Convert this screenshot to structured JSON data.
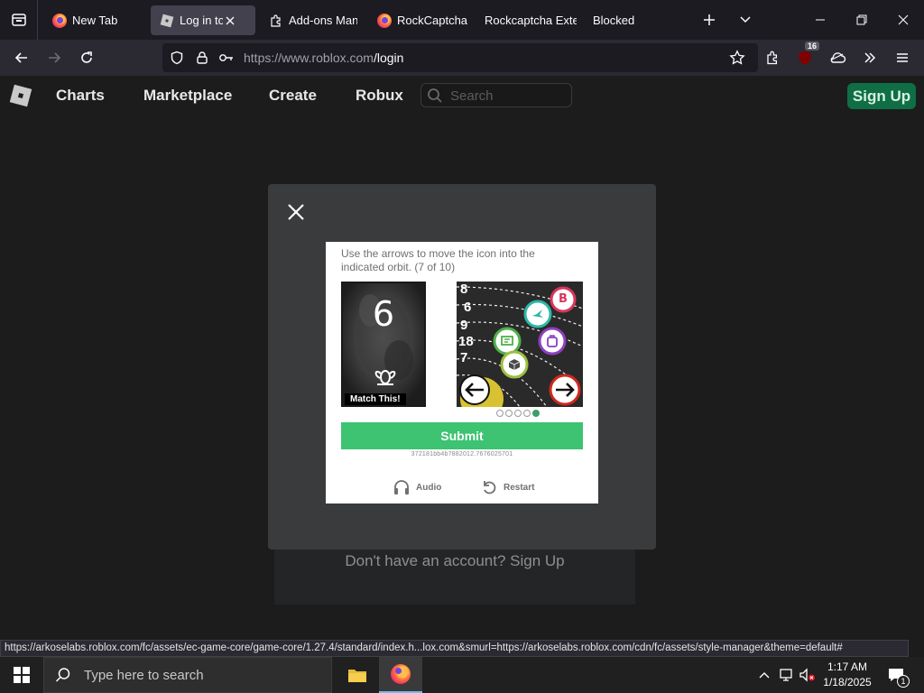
{
  "browser": {
    "tabs": [
      {
        "title": "New Tab",
        "icon": "firefox-icon",
        "active": false
      },
      {
        "title": "Log in to Ro",
        "icon": "roblox-favicon",
        "active": true
      },
      {
        "title": "Add-ons Man",
        "icon": "puzzle-icon",
        "active": false
      },
      {
        "title": "RockCaptcha",
        "icon": "firefox-icon",
        "active": false
      },
      {
        "title": "Rockcaptcha Exte",
        "icon": "",
        "active": false
      },
      {
        "title": "Blocked",
        "icon": "",
        "active": false
      }
    ],
    "url_host": "https://www.roblox.com",
    "url_path": "/login",
    "extension_badge": "16",
    "status_url": "https://arkoselabs.roblox.com/fc/assets/ec-game-core/game-core/1.27.4/standard/index.h...lox.com&smurl=https://arkoselabs.roblox.com/cdn/fc/assets/style-manager&theme=default#"
  },
  "roblox": {
    "nav": [
      "Charts",
      "Marketplace",
      "Create",
      "Robux"
    ],
    "search_placeholder": "Search",
    "signup_label": "Sign Up",
    "dont_have_account": "Don't have an account? Sign Up"
  },
  "captcha": {
    "instruction": "Use the arrows to move the icon into the indicated orbit. (7 of 10)",
    "target_number": "6",
    "match_label": "Match This!",
    "orbit_labels": [
      "8",
      "6",
      "9",
      "18",
      "7"
    ],
    "progress_total": 5,
    "progress_current": 5,
    "submit_label": "Submit",
    "session_id": "372181bb4b7882012.7676025701",
    "audio_label": "Audio",
    "restart_label": "Restart",
    "accent_color": "#3dc371"
  },
  "taskbar": {
    "search_placeholder": "Type here to search",
    "time": "1:17 AM",
    "date": "1/18/2025",
    "notification_count": "1"
  }
}
